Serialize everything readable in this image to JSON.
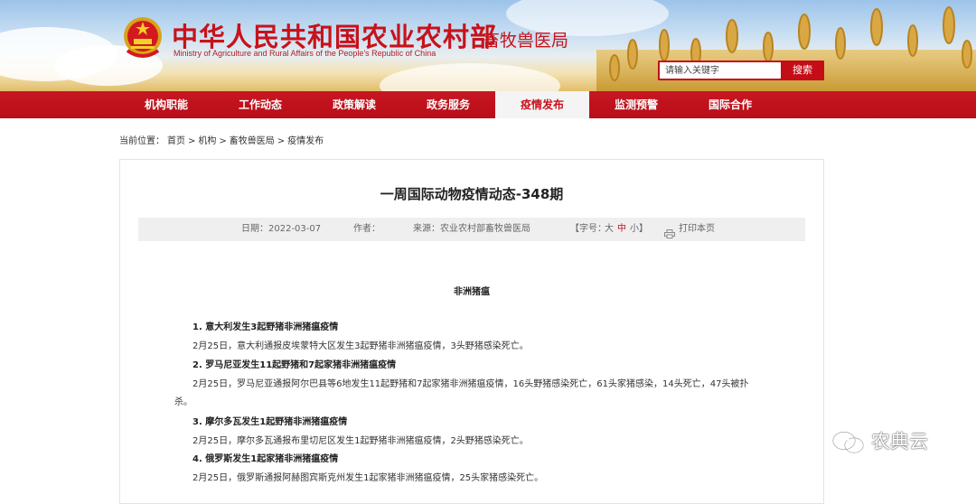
{
  "header": {
    "title_cn": "中华人民共和国农业农村部",
    "title_en": "Ministry of Agriculture and Rural Affairs of the People's Republic of China",
    "department": "畜牧兽医局",
    "search": {
      "placeholder": "请输入关键字",
      "button": "搜索"
    }
  },
  "nav": {
    "items": [
      {
        "label": "机构职能"
      },
      {
        "label": "工作动态"
      },
      {
        "label": "政策解读"
      },
      {
        "label": "政务服务"
      },
      {
        "label": "疫情发布"
      },
      {
        "label": "监测预警"
      },
      {
        "label": "国际合作"
      }
    ],
    "active_index": 4
  },
  "breadcrumb": {
    "prefix": "当前位置：",
    "items": [
      "首页",
      "机构",
      "畜牧兽医局",
      "疫情发布"
    ],
    "separator": ">"
  },
  "article": {
    "title": "一周国际动物疫情动态-348期",
    "meta": {
      "date": "日期：2022-03-07",
      "author": "作者：",
      "source": "来源：农业农村部畜牧兽医局",
      "font_label_open": "【字号：",
      "font_large": "大",
      "font_medium": "中",
      "font_small": "小",
      "font_label_close": "】",
      "print": "打印本页"
    },
    "section": "非洲猪瘟",
    "items": [
      {
        "heading": "1. 意大利发生3起野猪非洲猪瘟疫情",
        "text": "2月25日，意大利通报皮埃蒙特大区发生3起野猪非洲猪瘟疫情，3头野猪感染死亡。"
      },
      {
        "heading": "2. 罗马尼亚发生11起野猪和7起家猪非洲猪瘟疫情",
        "text": "2月25日，罗马尼亚通报阿尔巴县等6地发生11起野猪和7起家猪非洲猪瘟疫情，16头野猪感染死亡，61头家猪感染，14头死亡，47头被扑",
        "text_cont": "杀。"
      },
      {
        "heading": "3. 摩尔多瓦发生1起野猪非洲猪瘟疫情",
        "text": "2月25日，摩尔多瓦通报布里切尼区发生1起野猪非洲猪瘟疫情，2头野猪感染死亡。"
      },
      {
        "heading": "4. 俄罗斯发生1起家猪非洲猪瘟疫情",
        "text": "2月25日，俄罗斯通报阿赫图宾斯克州发生1起家猪非洲猪瘟疫情，25头家猪感染死亡。"
      }
    ]
  },
  "watermark": {
    "text": "农典云",
    "icon": "wechat-icon"
  },
  "colors": {
    "brand_red": "#c8121b",
    "nav_red": "#b80d18",
    "meta_bg": "#efefef"
  }
}
